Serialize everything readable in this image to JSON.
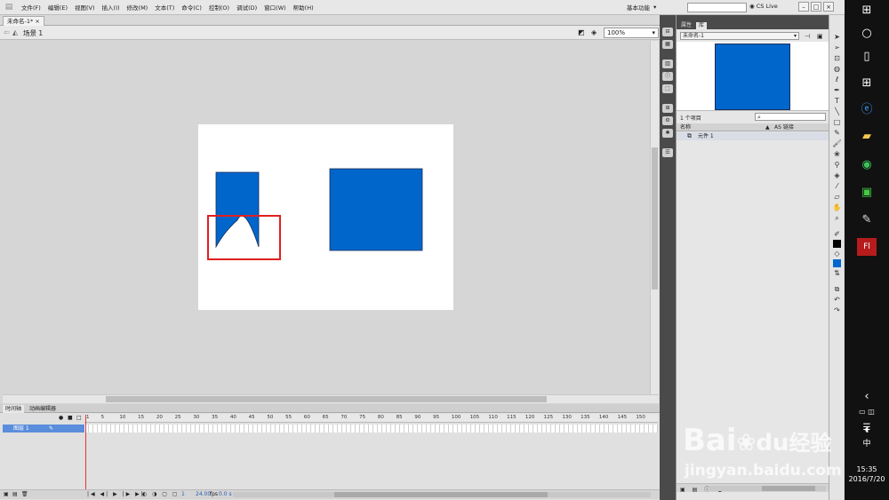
{
  "menubar": {
    "items": [
      "文件(F)",
      "编辑(E)",
      "视图(V)",
      "插入(I)",
      "修改(M)",
      "文本(T)",
      "命令(C)",
      "控制(O)",
      "调试(D)",
      "窗口(W)",
      "帮助(H)"
    ],
    "workspace": "基本功能",
    "cs_live": "CS Live"
  },
  "document": {
    "tab": "未命名-1*",
    "scene": "场景 1",
    "zoom": "100%"
  },
  "stage": {
    "shape_color": "#0066cc",
    "highlight_color": "#e02020"
  },
  "timeline": {
    "tabs": [
      "时间轴",
      "动画编辑器"
    ],
    "ruler_ticks": [
      "1",
      "5",
      "10",
      "15",
      "20",
      "25",
      "30",
      "35",
      "40",
      "45",
      "50",
      "55",
      "60",
      "65",
      "70",
      "75",
      "80",
      "85",
      "90",
      "95",
      "100",
      "105",
      "110",
      "115",
      "120",
      "125",
      "130",
      "135",
      "140",
      "145",
      "150"
    ],
    "layer_name": "图层 1",
    "current_frame": "1",
    "fps": "24.00",
    "fps_unit": "fps",
    "time": "0.0 s"
  },
  "library": {
    "tabs": [
      "属性",
      "库"
    ],
    "doc": "未命名-1",
    "count": "1 个项目",
    "col_name": "名称",
    "col_linkage": "AS 链接",
    "item": "元件 1"
  },
  "taskbar": {
    "time": "15:35",
    "date": "2016/7/20",
    "ime": "中"
  },
  "watermark": {
    "line1": "Bai",
    "line1b": "经验",
    "line2": "jingyan.baidu.com"
  }
}
